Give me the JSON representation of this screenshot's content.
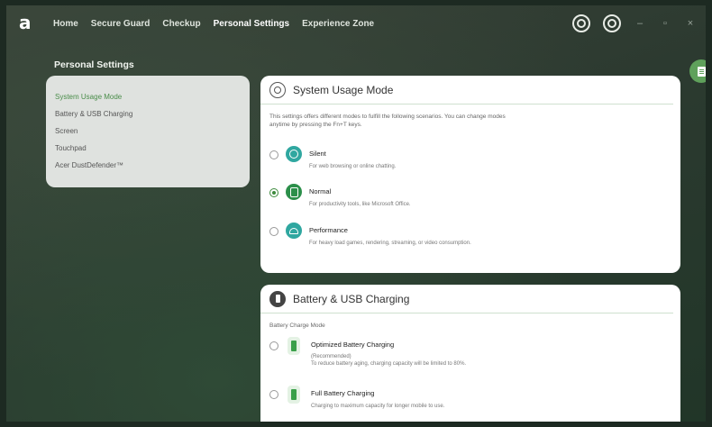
{
  "nav": {
    "items": [
      "Home",
      "Secure Guard",
      "Checkup",
      "Personal Settings",
      "Experience Zone"
    ],
    "active": "Personal Settings"
  },
  "window": {
    "minimize": "–",
    "restore": "▫",
    "close": "×"
  },
  "page": {
    "title": "Personal Settings"
  },
  "menu": {
    "items": [
      "System Usage Mode",
      "Battery & USB Charging",
      "Screen",
      "Touchpad",
      "Acer DustDefender™"
    ],
    "active": "System Usage Mode"
  },
  "usage_card": {
    "title": "System Usage Mode",
    "description": "This settings offers different modes to fulfill the following scenarios. You can change modes anytime by pressing the Fn+T keys.",
    "options": [
      {
        "label": "Silent",
        "desc": "For web browsing or online chatting.",
        "selected": false,
        "icon": "silent-icon"
      },
      {
        "label": "Normal",
        "desc": "For productivity tools, like Microsoft Office.",
        "selected": true,
        "icon": "normal-icon"
      },
      {
        "label": "Performance",
        "desc": "For heavy load games, rendering, streaming, or video consumption.",
        "selected": false,
        "icon": "performance-icon"
      }
    ]
  },
  "battery_card": {
    "title": "Battery & USB Charging",
    "mode_label": "Battery Charge Mode",
    "options": [
      {
        "label": "Optimized Battery Charging",
        "note": "(Recommended)",
        "desc": "To reduce battery aging, charging capacity will be limited to 80%.",
        "selected": false
      },
      {
        "label": "Full Battery Charging",
        "desc": "Charging to maximum capacity for longer mobile to use.",
        "selected": false
      }
    ]
  },
  "colors": {
    "accent": "#3d8a3d",
    "active_menu": "#4a8d4a",
    "mode_icon": "#2fa7a0"
  }
}
